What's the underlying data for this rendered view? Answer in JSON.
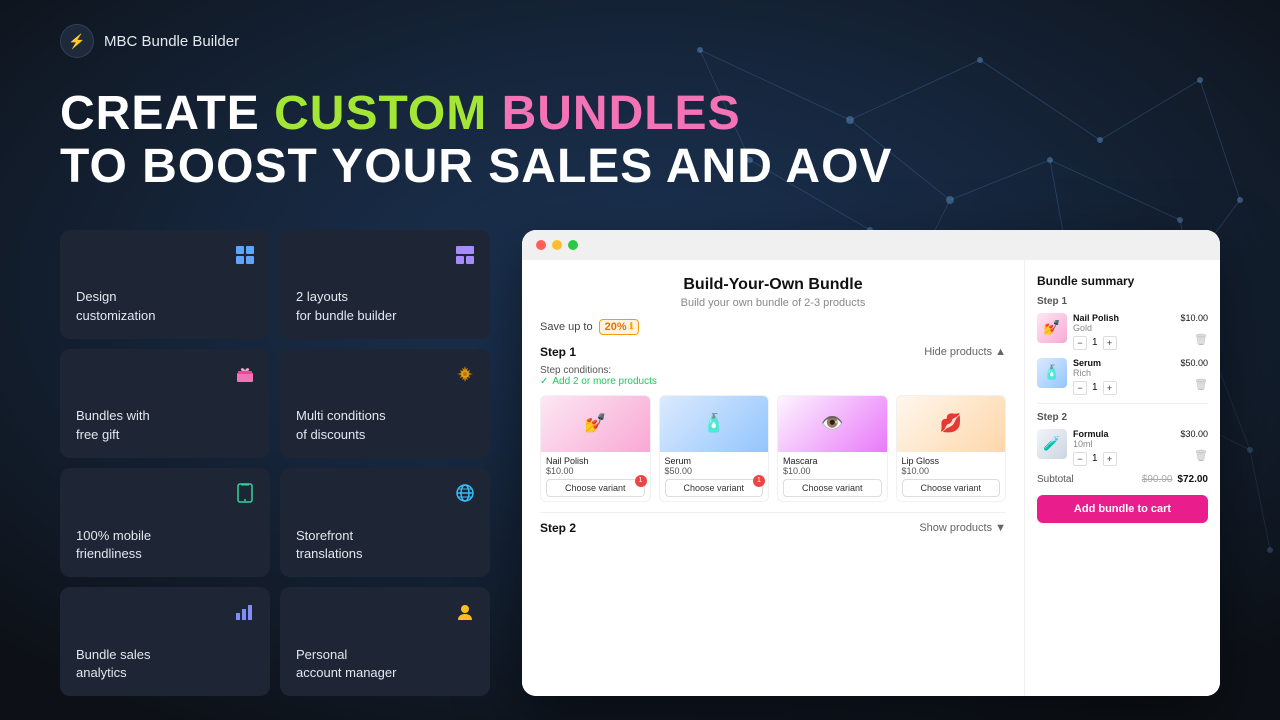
{
  "app": {
    "logo_symbol": "⚡",
    "logo_name": "MBC Bundle Builder"
  },
  "hero": {
    "line1_part1": "CREATE ",
    "line1_part2": "CUSTOM ",
    "line1_part3": "BUNDLES",
    "line2": "TO BOOST YOUR SALES AND AOV"
  },
  "features": [
    {
      "id": "design-customization",
      "label": "Design customization",
      "icon": "🟦",
      "icon_type": "grid"
    },
    {
      "id": "2-layouts",
      "label": "2 layouts for bundle builder",
      "icon": "🟪",
      "icon_type": "layout"
    },
    {
      "id": "bundles-free-gift",
      "label": "Bundles with free gift",
      "icon": "🎁",
      "icon_type": "gift"
    },
    {
      "id": "multi-conditions",
      "label": "Multi conditions of discounts",
      "icon": "⚙️",
      "icon_type": "gear"
    },
    {
      "id": "mobile",
      "label": "100% mobile friendliness",
      "icon": "📱",
      "icon_type": "mobile"
    },
    {
      "id": "storefront",
      "label": "Storefront translations",
      "icon": "🌐",
      "icon_type": "globe"
    },
    {
      "id": "analytics",
      "label": "Bundle sales analytics",
      "icon": "📊",
      "icon_type": "chart"
    },
    {
      "id": "account-manager",
      "label": "Personal account manager",
      "icon": "👤",
      "icon_type": "person"
    }
  ],
  "bundle_builder": {
    "title": "Build-Your-Own Bundle",
    "subtitle": "Build your own bundle of 2-3 products",
    "save_text": "Save up to",
    "save_percent": "20%",
    "step1_label": "Step 1",
    "hide_products": "Hide products",
    "step_conditions_label": "Step conditions:",
    "step_condition_green": "Add 2 or more products",
    "products": [
      {
        "name": "Nail Polish",
        "price": "$10.00",
        "badge": "1",
        "color_class": "img-nail-polish",
        "emoji": "💅"
      },
      {
        "name": "Serum",
        "price": "$50.00",
        "badge": "1",
        "color_class": "img-serum",
        "emoji": "🧴"
      },
      {
        "name": "Mascara",
        "price": "$10.00",
        "badge": null,
        "color_class": "img-mascara",
        "emoji": "👁️"
      },
      {
        "name": "Lip Gloss",
        "price": "$10.00",
        "badge": null,
        "color_class": "img-lip-gloss",
        "emoji": "💋"
      }
    ],
    "step2_label": "Step 2",
    "show_products": "Show products"
  },
  "bundle_summary": {
    "title": "Bundle summary",
    "step1_label": "Step 1",
    "items_step1": [
      {
        "name": "Nail Polish",
        "variant": "Gold",
        "price": "$10.00",
        "qty": 1,
        "emoji": "💅",
        "color_class": "img-nail-polish"
      },
      {
        "name": "Serum",
        "variant": "Rich",
        "price": "$50.00",
        "qty": 1,
        "emoji": "🧴",
        "color_class": "img-serum"
      }
    ],
    "step2_label": "Step 2",
    "items_step2": [
      {
        "name": "Formula",
        "variant": "10ml",
        "price": "$30.00",
        "qty": 1,
        "emoji": "🧪",
        "color_class": "img-formula"
      }
    ],
    "subtotal_label": "Subtotal",
    "subtotal_original": "$90.00",
    "subtotal_discounted": "$72.00",
    "add_btn_label": "Add bundle to cart"
  }
}
